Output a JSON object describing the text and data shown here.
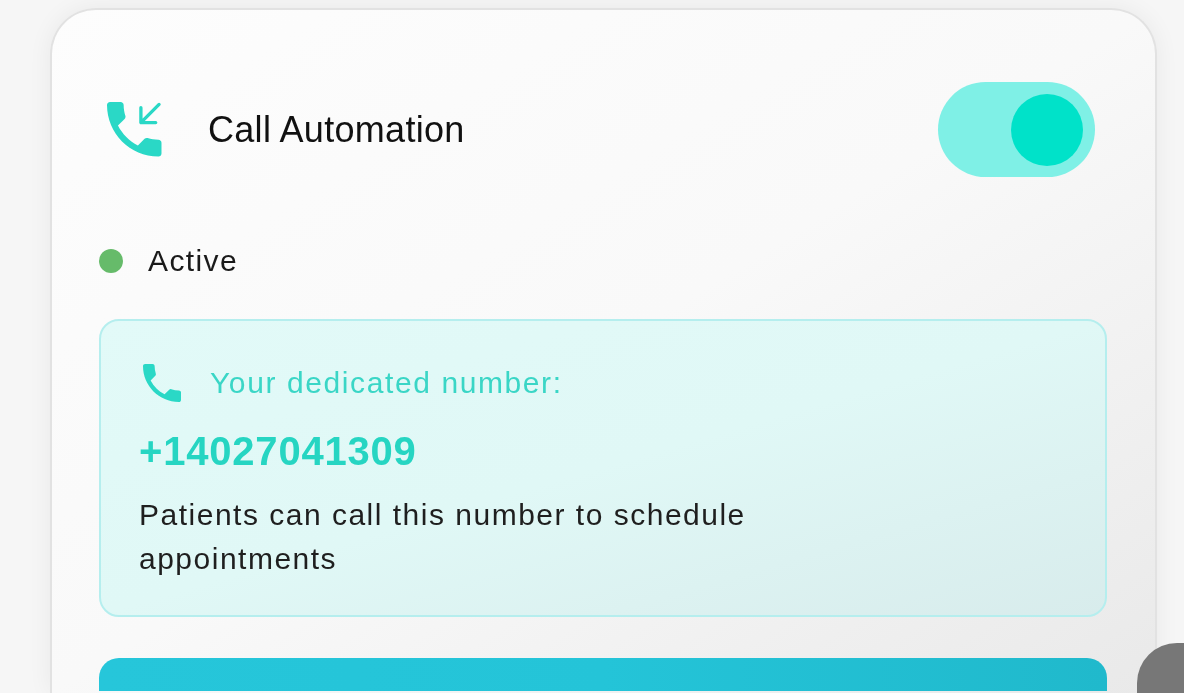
{
  "card": {
    "title": "Call Automation",
    "toggle": {
      "on": true
    },
    "status": {
      "label": "Active",
      "active": true
    },
    "dedicated_number": {
      "label": "Your dedicated number:",
      "number": "+14027041309",
      "description": "Patients can call this number to schedule appointments"
    }
  }
}
